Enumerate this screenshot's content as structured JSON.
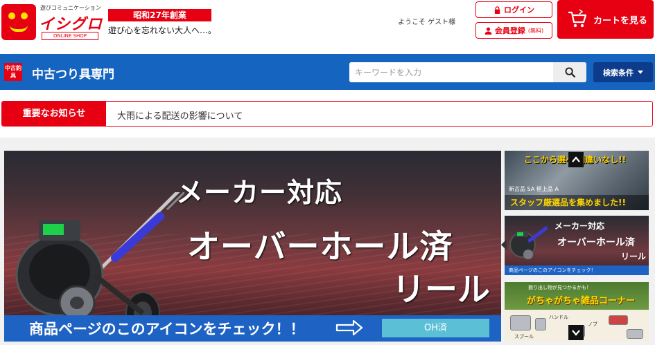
{
  "header": {
    "logo": {
      "tagline_small": "遊びコミュニケーション",
      "name": "イシグロ",
      "shop_label": "ONLINE SHOP"
    },
    "founded": "昭和27年創業",
    "catchphrase": "遊び心を忘れない大人へ…。",
    "welcome": "ようこそ ゲスト様",
    "login_label": "ログイン",
    "register_label": "会員登録",
    "register_note": "(無料)",
    "cart_label": "カートを見る"
  },
  "nav": {
    "badge": "中古釣具",
    "title": "中古つり具専門",
    "search_placeholder": "キーワードを入力",
    "search_conditions": "検索条件"
  },
  "notice": {
    "label": "重要なお知らせ",
    "text": "大雨による配送の影響について"
  },
  "hero": {
    "line1": "メーカー対応",
    "line2": "オーバーホール済",
    "line3": "リール",
    "bar_text": "商品ページのこのアイコンをチェック！！",
    "badge": "OH済"
  },
  "side": {
    "thumb1": {
      "top": "ここから選べ 間違いなし!!",
      "mid": "新古品 SA 極上品 A",
      "bottom": "スタッフ厳選品を集めました!!"
    },
    "thumb2": {
      "line1": "メーカー対応",
      "line2": "オーバーホール済",
      "line3": "リール",
      "bar": "商品ページのこのアイコンをチェック！"
    },
    "thumb3": {
      "line1": "掘り出し物が見つかるかも！",
      "line2": "がちゃがちゃ雑品コーナー",
      "label_spool": "スプール",
      "label_handle": "ハンドル",
      "label_knob": "ノブ"
    }
  },
  "colors": {
    "brand_red": "#e60012",
    "nav_blue": "#1565c0",
    "nav_dark_blue": "#0d3c8c",
    "oh_badge": "#5bc0d6"
  },
  "icons": {
    "login": "lock-icon",
    "register": "user-icon",
    "cart": "cart-icon",
    "search": "search-icon",
    "scroll_up": "chevron-up-icon",
    "scroll_down": "chevron-down-icon"
  }
}
